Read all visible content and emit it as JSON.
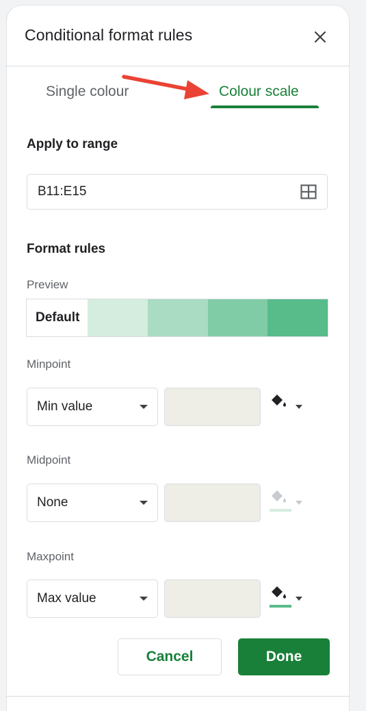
{
  "header": {
    "title": "Conditional format rules",
    "close_icon": "close-icon"
  },
  "tabs": [
    {
      "label": "Single colour",
      "active": false
    },
    {
      "label": "Colour scale",
      "active": true
    }
  ],
  "apply_range": {
    "label": "Apply to range",
    "value": "B11:E15",
    "icon": "grid-icon"
  },
  "format_rules": {
    "label": "Format rules",
    "preview_label": "Preview",
    "preview_default": "Default",
    "preview_colors": [
      "#d4eddf",
      "#aadcc3",
      "#80cca6",
      "#57bb8a"
    ]
  },
  "minpoint": {
    "label": "Minpoint",
    "type": "Min value",
    "value": "",
    "fill_color": "#ffffff",
    "enabled": true
  },
  "midpoint": {
    "label": "Midpoint",
    "type": "None",
    "value": "",
    "fill_color": "#d4eddf",
    "enabled": false
  },
  "maxpoint": {
    "label": "Maxpoint",
    "type": "Max value",
    "value": "",
    "fill_color": "#57bb8a",
    "enabled": true
  },
  "actions": {
    "cancel": "Cancel",
    "done": "Done"
  },
  "colors": {
    "accent": "#188038",
    "arrow": "#ea4335",
    "input_bg": "#eeede6"
  }
}
